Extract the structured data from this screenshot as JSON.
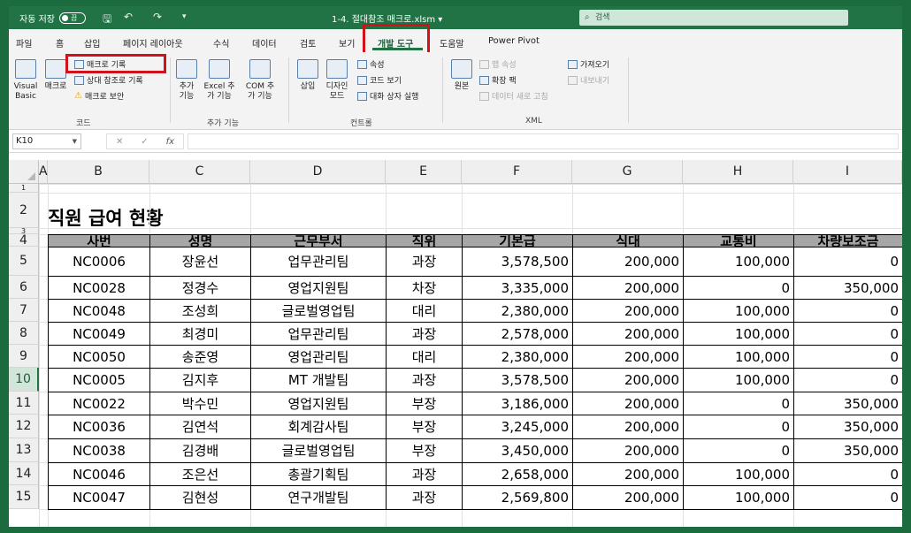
{
  "titlebar": {
    "autosave_label": "자동 저장",
    "autosave_state": "끔",
    "filename": "1-4. 절대참조 매크로.xlsm",
    "filename_caret": "▾",
    "search_placeholder": "검색"
  },
  "ribbon_tabs": [
    "파일",
    "홈",
    "삽입",
    "페이지 레이아웃",
    "수식",
    "데이터",
    "검토",
    "보기",
    "개발 도구",
    "도움말",
    "Power Pivot"
  ],
  "active_tab": "개발 도구",
  "ribbon": {
    "code": {
      "visual_basic": "Visual Basic",
      "macro": "매크로",
      "record_macro": "매크로 기록",
      "relative_ref": "상대 참조로 기록",
      "macro_security": "매크로 보안",
      "group_label": "코드"
    },
    "addins": {
      "addins": "추가 기능",
      "excel_addins": "Excel 추가 기능",
      "com_addins": "COM 추가 기능",
      "group_label": "추가 기능"
    },
    "controls": {
      "insert": "삽입",
      "design_mode": "디자인 모드",
      "properties": "속성",
      "view_code": "코드 보기",
      "run_dialog": "대화 상자 실행",
      "group_label": "컨트롤"
    },
    "xml": {
      "source": "원본",
      "map_properties": "맵 속성",
      "expansion_packs": "확장 팩",
      "refresh_data": "데이터 새로 고침",
      "import": "가져오기",
      "export": "내보내기",
      "group_label": "XML"
    }
  },
  "formula_bar": {
    "name_box": "K10",
    "cancel": "✕",
    "enter": "✓",
    "fx": "fx",
    "formula": ""
  },
  "sheet": {
    "columns": [
      "A",
      "B",
      "C",
      "D",
      "E",
      "F",
      "G",
      "H",
      "I"
    ],
    "rows": [
      "1",
      "2",
      "3",
      "4",
      "5",
      "6",
      "7",
      "8",
      "9",
      "10",
      "11",
      "12",
      "13",
      "14",
      "15"
    ],
    "selected_row": "10",
    "title": "직원 급여 현황",
    "headers": [
      "사번",
      "성명",
      "근무부서",
      "직위",
      "기본급",
      "식대",
      "교통비",
      "차량보조금"
    ],
    "data": [
      [
        "NC0006",
        "장윤선",
        "업무관리팀",
        "과장",
        "3,578,500",
        "200,000",
        "100,000",
        "0"
      ],
      [
        "NC0028",
        "정경수",
        "영업지원팀",
        "차장",
        "3,335,000",
        "200,000",
        "0",
        "350,000"
      ],
      [
        "NC0048",
        "조성희",
        "글로벌영업팀",
        "대리",
        "2,380,000",
        "200,000",
        "100,000",
        "0"
      ],
      [
        "NC0049",
        "최경미",
        "업무관리팀",
        "과장",
        "2,578,000",
        "200,000",
        "100,000",
        "0"
      ],
      [
        "NC0050",
        "송준영",
        "영업관리팀",
        "대리",
        "2,380,000",
        "200,000",
        "100,000",
        "0"
      ],
      [
        "NC0005",
        "김지후",
        "MT 개발팀",
        "과장",
        "3,578,500",
        "200,000",
        "100,000",
        "0"
      ],
      [
        "NC0022",
        "박수민",
        "영업지원팀",
        "부장",
        "3,186,000",
        "200,000",
        "0",
        "350,000"
      ],
      [
        "NC0036",
        "김연석",
        "회계감사팀",
        "부장",
        "3,245,000",
        "200,000",
        "0",
        "350,000"
      ],
      [
        "NC0038",
        "김경배",
        "글로벌영업팀",
        "부장",
        "3,450,000",
        "200,000",
        "0",
        "350,000"
      ],
      [
        "NC0046",
        "조은선",
        "총괄기획팀",
        "과장",
        "2,658,000",
        "200,000",
        "100,000",
        "0"
      ],
      [
        "NC0047",
        "김현성",
        "연구개발팀",
        "과장",
        "2,569,800",
        "200,000",
        "100,000",
        "0"
      ]
    ]
  },
  "colors": {
    "excel_green": "#217346",
    "highlight_red": "#d0121b",
    "header_fill": "#a6a6a6"
  }
}
